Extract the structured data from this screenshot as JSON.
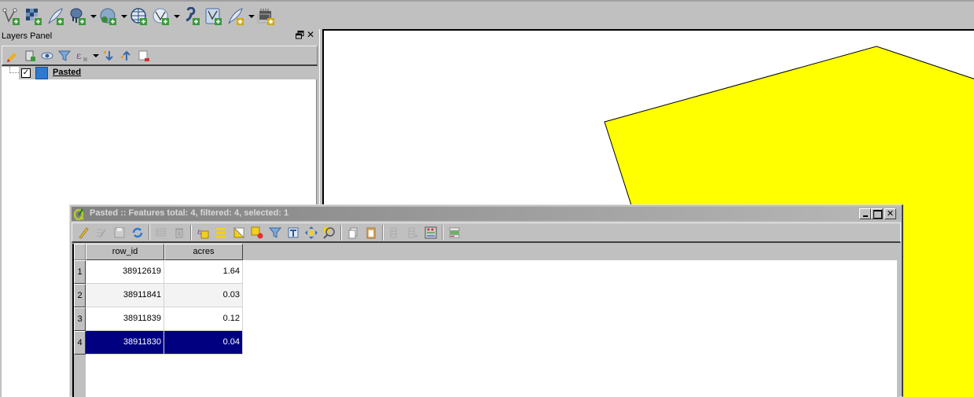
{
  "top_toolbar": {
    "icons": [
      {
        "name": "add-vector-layer-icon"
      },
      {
        "name": "add-raster-layer-icon"
      },
      {
        "name": "add-spatialite-layer-icon"
      },
      {
        "name": "add-postgis-layer-icon",
        "dropdown": true
      },
      {
        "name": "add-wms-layer-icon",
        "dropdown": true
      },
      {
        "name": "add-wcs-layer-icon"
      },
      {
        "name": "add-wfs-layer-icon",
        "dropdown": true
      },
      {
        "name": "add-delimited-text-layer-icon"
      },
      {
        "name": "add-virtual-layer-icon"
      },
      {
        "name": "new-spatialite-layer-icon",
        "dropdown": true
      },
      {
        "name": "new-memory-layer-icon"
      }
    ]
  },
  "layers_panel": {
    "title": "Layers Panel",
    "float_icon": "float-icon",
    "close_icon": "✕",
    "toolbar": [
      "style-manager-icon",
      "add-group-icon",
      "visibility-icon",
      "filter-legend-icon",
      "filter-expression-icon",
      "expand-all-icon",
      "collapse-all-icon",
      "remove-layer-icon"
    ],
    "layers": [
      {
        "name": "Pasted",
        "checked": true,
        "check_mark": "✓",
        "color": "#2a7bd0"
      }
    ]
  },
  "map": {
    "polygon_fill": "#ffff00",
    "polygon_stroke": "#000000",
    "background": "#ffffff"
  },
  "attribute_table": {
    "title": "Pasted :: Features total: 4, filtered: 4, selected: 1",
    "window_buttons": {
      "minimize": "",
      "maximize": "",
      "close": "✕"
    },
    "toolbar": [
      "toggle-editing-icon",
      "toggle-multiedit-icon",
      "save-edits-icon",
      "reload-icon",
      "|",
      "add-feature-icon",
      "delete-feature-icon",
      "|",
      "select-by-expression-icon",
      "select-all-icon",
      "invert-selection-icon",
      "deselect-all-icon",
      "filter-select-icon",
      "move-selection-top-icon",
      "pan-to-selection-icon",
      "zoom-to-selection-icon",
      "|",
      "copy-icon",
      "paste-icon",
      "|",
      "new-field-icon",
      "delete-field-icon",
      "field-calculator-icon",
      "|",
      "conditional-formatting-icon"
    ],
    "columns": [
      "row_id",
      "acres"
    ],
    "rows": [
      {
        "num": "1",
        "row_id": "38912619",
        "acres": "1.64"
      },
      {
        "num": "2",
        "row_id": "38911841",
        "acres": "0.03"
      },
      {
        "num": "3",
        "row_id": "38911839",
        "acres": "0.12"
      },
      {
        "num": "4",
        "row_id": "38911830",
        "acres": "0.04",
        "selected": true
      }
    ],
    "selection_color": "#000080"
  }
}
